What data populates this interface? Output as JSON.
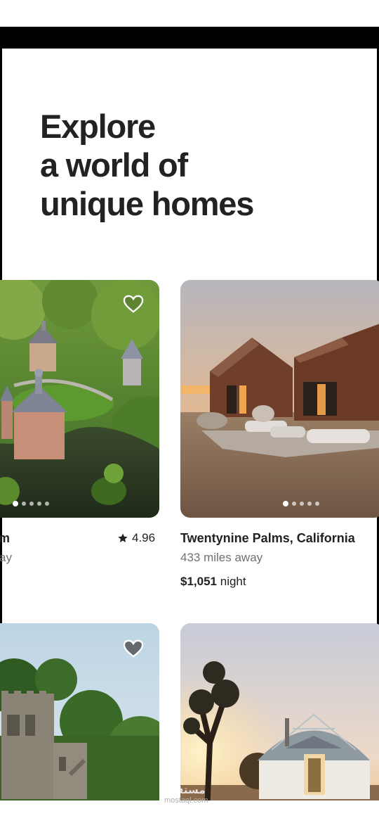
{
  "headline": {
    "line1": "Explore",
    "line2": "a world of",
    "line3": "unique homes"
  },
  "listings": [
    {
      "title_partial": "m",
      "subtitle_partial": "ay",
      "rating": "4.96",
      "image": "castle-with-moat",
      "favorite_icon": "heart-outline-icon",
      "photo_count": 5,
      "active_photo": 1
    },
    {
      "title": "Twentynine Palms, California",
      "subtitle": "433 miles away",
      "price": "$1,051",
      "price_unit": "night",
      "image": "desert-cabins-at-sunset",
      "photo_count": 5,
      "active_photo": 1
    },
    {
      "image": "stone-ruin-in-forest",
      "favorite_icon": "heart-filled-icon"
    },
    {
      "image": "geodesic-dome-with-joshua-tree"
    }
  ],
  "colors": {
    "text_primary": "#222222",
    "text_secondary": "#717171",
    "background": "#ffffff"
  },
  "watermark": {
    "arabic": "مستقل",
    "latin": "mostaql.com"
  }
}
